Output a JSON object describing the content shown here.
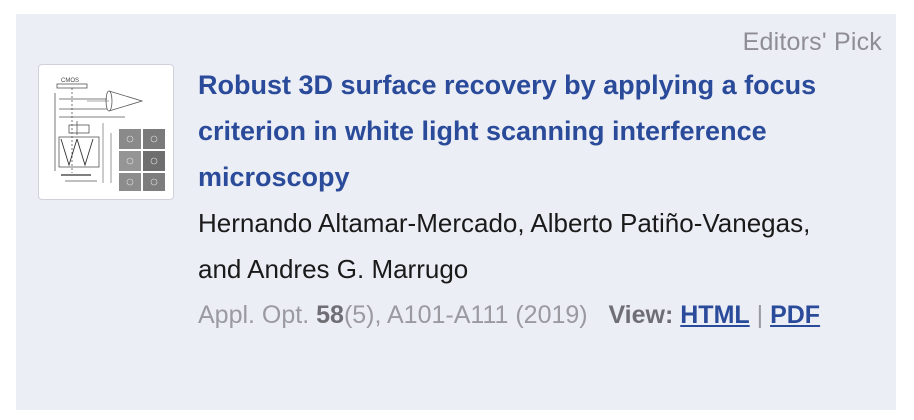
{
  "badge": "Editors' Pick",
  "article": {
    "title": "Robust 3D surface recovery by applying a focus criterion in white light scanning interference microscopy",
    "authors": "Hernando Altamar-Mercado, Alberto Patiño-Vanegas, and Andres G. Marrugo",
    "journal": "Appl. Opt.",
    "volume": "58",
    "issue": "(5), A101-A111 (2019)",
    "view_label": "View:",
    "html_label": "HTML",
    "separator": "|",
    "pdf_label": "PDF"
  },
  "thumbnail": {
    "icon": "figure-thumbnail",
    "top_label": "CMOS"
  }
}
